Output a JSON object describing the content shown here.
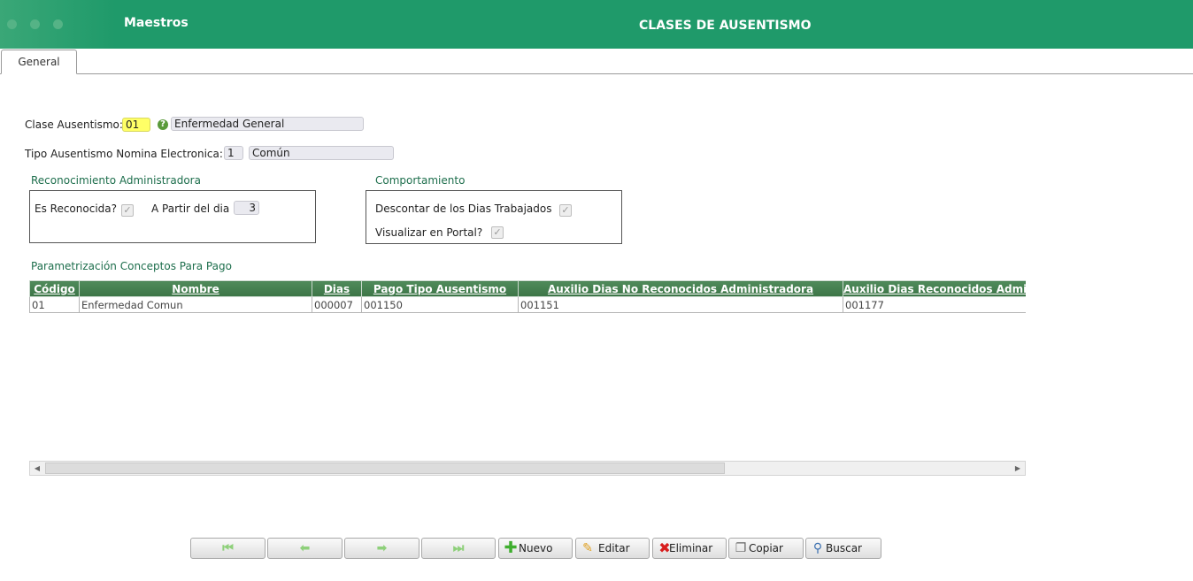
{
  "header": {
    "app_title": "Maestros",
    "page_title": "CLASES DE AUSENTISMO"
  },
  "tabs": [
    {
      "label": "General"
    }
  ],
  "form": {
    "clase_label": "Clase Ausentismo:",
    "clase_code": "01",
    "clase_desc": "Enfermedad General",
    "tipo_label": "Tipo Ausentismo Nomina Electronica:",
    "tipo_code": "1",
    "tipo_desc": "Común"
  },
  "reconocimiento": {
    "title": "Reconocimiento Administradora",
    "es_reconocida_label": "Es Reconocida?",
    "es_reconocida_checked": true,
    "a_partir_label": "A Partir del dia",
    "a_partir_value": "3"
  },
  "comportamiento": {
    "title": "Comportamiento",
    "descontar_label": "Descontar de los Dias Trabajados",
    "descontar_checked": true,
    "visualizar_label": "Visualizar en Portal?",
    "visualizar_checked": true
  },
  "conceptos": {
    "title": "Parametrización Conceptos Para Pago",
    "columns": [
      "Código",
      "Nombre",
      "Dias",
      "Pago Tipo Ausentismo",
      "Auxilio Dias No Reconocidos Administradora",
      "Auxilio Dias Reconocidos Administradora"
    ],
    "rows": [
      [
        "01",
        "Enfermedad Comun",
        "000007",
        "001150",
        "001151",
        "001177"
      ]
    ]
  },
  "toolbar": {
    "first_icon": "first-record-icon",
    "prev_icon": "previous-record-icon",
    "next_icon": "next-record-icon",
    "last_icon": "last-record-icon",
    "nuevo": "Nuevo",
    "editar": "Editar",
    "eliminar": "Eliminar",
    "copiar": "Copiar",
    "buscar": "Buscar"
  },
  "colors": {
    "header": "#1f9a6a",
    "grid_header": "#3c7547",
    "section_title": "#1d6e4c",
    "highlight_field": "#ffff66"
  }
}
